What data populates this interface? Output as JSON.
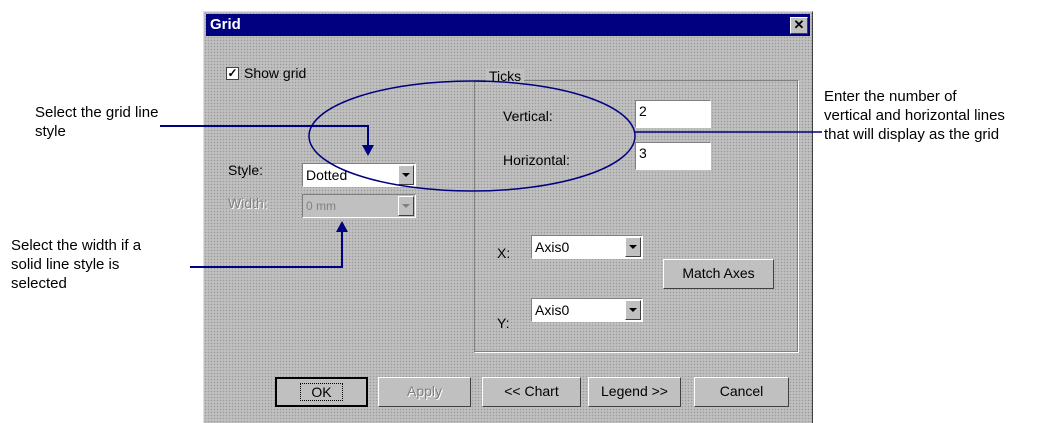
{
  "dialog": {
    "title": "Grid",
    "close_icon": "close-icon",
    "show_grid": {
      "label": "Show grid",
      "checked": true
    },
    "style": {
      "label": "Style:",
      "value": "Dotted"
    },
    "width": {
      "label": "Width:",
      "value": "0 mm",
      "disabled": true
    },
    "ticks": {
      "title": "Ticks",
      "vertical_label": "Vertical:",
      "vertical_value": "2",
      "horizontal_label": "Horizontal:",
      "horizontal_value": "3"
    },
    "x_axis": {
      "label": "X:",
      "value": "Axis0"
    },
    "y_axis": {
      "label": "Y:",
      "value": "Axis0"
    },
    "match_axes_label": "Match Axes",
    "buttons": {
      "ok": "OK",
      "apply": "Apply",
      "chart": "<< Chart",
      "legend": "Legend >>",
      "cancel": "Cancel"
    }
  },
  "annotations": {
    "style_line1": "Select the grid line",
    "style_line2": "style",
    "width_line1": "Select the width if a",
    "width_line2": "solid line style is",
    "width_line3": "selected",
    "ticks_line1": "Enter the number of",
    "ticks_line2": "vertical and horizontal lines",
    "ticks_line3": "that will display as the grid"
  },
  "colors": {
    "title_bar": "#000080",
    "dialog_face": "#c0c0c0",
    "callout_line": "#000080"
  }
}
